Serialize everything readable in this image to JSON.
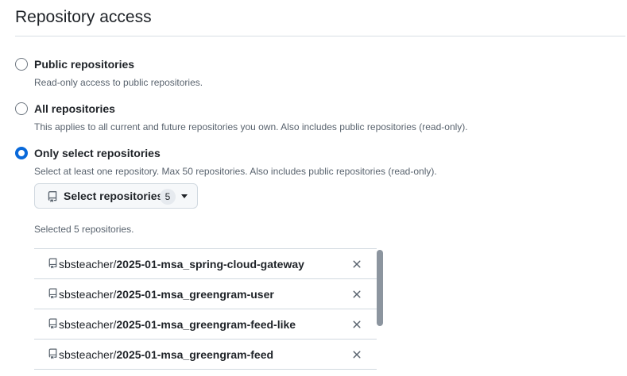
{
  "section": {
    "title": "Repository access"
  },
  "options": [
    {
      "label": "Public repositories",
      "description": "Read-only access to public repositories.",
      "checked": false
    },
    {
      "label": "All repositories",
      "description": "This applies to all current and future repositories you own. Also includes public repositories (read-only).",
      "checked": false
    },
    {
      "label": "Only select repositories",
      "description": "Select at least one repository. Max 50 repositories. Also includes public repositories (read-only).",
      "checked": true
    }
  ],
  "select_button": {
    "label": "Select repositories",
    "count": "5"
  },
  "selected_summary": "Selected 5 repositories.",
  "repositories": [
    {
      "owner": "sbsteacher/",
      "name": "2025-01-msa_spring-cloud-gateway"
    },
    {
      "owner": "sbsteacher/",
      "name": "2025-01-msa_greengram-user"
    },
    {
      "owner": "sbsteacher/",
      "name": "2025-01-msa_greengram-feed-like"
    },
    {
      "owner": "sbsteacher/",
      "name": "2025-01-msa_greengram-feed"
    }
  ],
  "icons": {
    "repo": "repo-icon",
    "remove": "x-icon",
    "caret": "triangle-down-icon"
  },
  "colors": {
    "accent": "#0969da",
    "text": "#1f2328",
    "muted": "#59636e",
    "border": "#d1d9e0"
  }
}
